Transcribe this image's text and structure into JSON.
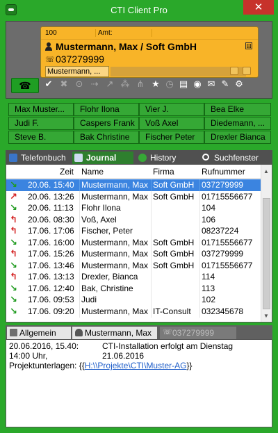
{
  "window": {
    "title": "CTI Client Pro",
    "close_label": "✕"
  },
  "call": {
    "line_number": "100",
    "amt_label": "Amt:",
    "caller_name": "Mustermann, Max  /  Soft GmbH",
    "caller_number": "037279999",
    "subtab_label": "Mustermann, ...",
    "collapse_label": "⊟"
  },
  "toolbar": {
    "icons": [
      "check-icon",
      "cancel-icon",
      "toggle-icon",
      "transfer-icon",
      "forward-icon",
      "conference-icon",
      "network-icon",
      "star-icon",
      "clock-icon",
      "contact-card-icon",
      "person-icon",
      "mail-icon",
      "note-icon",
      "gear-icon"
    ]
  },
  "speeddial": [
    [
      "Max Muster...",
      "Flohr Ilona",
      "Vier J.",
      "Bea Elke"
    ],
    [
      "Judi F.",
      "Caspers Frank",
      "Voß Axel",
      "Diedemann, ..."
    ],
    [
      "Steve B.",
      "Bak Christine",
      "Fischer Peter",
      "Drexler Bianca"
    ]
  ],
  "tabs": [
    "Telefonbuch",
    "Journal",
    "History",
    "Suchfenster"
  ],
  "journal": {
    "columns": [
      "Zeit",
      "Name",
      "Firma",
      "Rufnummer"
    ],
    "rows": [
      {
        "dir": "in",
        "time": "20.06. 15:40",
        "name": "Mustermann, Max",
        "firma": "Soft GmbH",
        "nummer": "037279999"
      },
      {
        "dir": "out",
        "time": "20.06. 13:26",
        "name": "Mustermann, Max",
        "firma": "Soft GmbH",
        "nummer": "01715556677"
      },
      {
        "dir": "in",
        "time": "20.06. 11:13",
        "name": "Flohr Ilona",
        "firma": "",
        "nummer": "104"
      },
      {
        "dir": "missed",
        "time": "20.06. 08:30",
        "name": "Voß, Axel",
        "firma": "",
        "nummer": "106"
      },
      {
        "dir": "missed",
        "time": "17.06. 17:06",
        "name": "Fischer, Peter",
        "firma": "",
        "nummer": "08237224"
      },
      {
        "dir": "in",
        "time": "17.06. 16:00",
        "name": "Mustermann, Max",
        "firma": "Soft GmbH",
        "nummer": "01715556677"
      },
      {
        "dir": "missed",
        "time": "17.06. 15:26",
        "name": "Mustermann, Max",
        "firma": "Soft GmbH",
        "nummer": "037279999"
      },
      {
        "dir": "in",
        "time": "17.06. 13:46",
        "name": "Mustermann, Max",
        "firma": "Soft GmbH",
        "nummer": "01715556677"
      },
      {
        "dir": "missed",
        "time": "17.06. 13:13",
        "name": "Drexler, Bianca",
        "firma": "",
        "nummer": "114"
      },
      {
        "dir": "in",
        "time": "17.06. 12:40",
        "name": "Bak, Christine",
        "firma": "",
        "nummer": "113"
      },
      {
        "dir": "in",
        "time": "17.06. 09:53",
        "name": "Judi",
        "firma": "",
        "nummer": "102"
      },
      {
        "dir": "in",
        "time": "17.06. 09:20",
        "name": "Mustermann, Max",
        "firma": "IT-Consult",
        "nummer": "032345678"
      }
    ]
  },
  "bottom_tabs": [
    "Allgemein",
    "Mustermann, Max",
    "037279999"
  ],
  "detail": {
    "line1_left": "20.06.2016, 15.40:",
    "line1_right": "CTI-Installation erfolgt am Dienstag 21.06.2016",
    "line2": "14:00 Uhr,",
    "line3_prefix": "Projektunterlagen: {{",
    "line3_link": "H:\\\\Projekte\\CTI\\Muster-AG",
    "line3_suffix": "}}"
  }
}
